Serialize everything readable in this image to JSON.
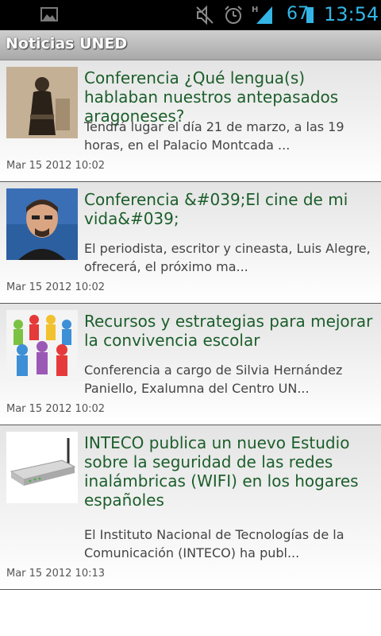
{
  "status_bar": {
    "battery": "67",
    "time": "13:54",
    "network": "H"
  },
  "header": {
    "title": "Noticias UNED"
  },
  "news": [
    {
      "title": "Conferencia ¿Qué lengua(s) hablaban nuestros antepasados aragoneses?",
      "summary": "Tendrá lugar el día 21 de marzo, a las 19 horas, en el Palacio Montcada ...",
      "date": "Mar 15 2012 10:02",
      "thumbnail": "old-photo-woman"
    },
    {
      "title": "Conferencia &#039;El cine de mi vida&#039;",
      "summary": "El periodista, escritor y cineasta, Luis Alegre, ofrecerá, el próximo ma...",
      "date": "Mar 15 2012 10:02",
      "thumbnail": "portrait-man"
    },
    {
      "title": "Recursos y estrategias para mejorar la convivencia escolar",
      "summary": "Conferencia a cargo de Silvia Hernández Paniello, Exalumna del Centro UN...",
      "date": "Mar 15 2012 10:02",
      "thumbnail": "paper-people-circle"
    },
    {
      "title": "INTECO publica un nuevo Estudio sobre la seguridad de las redes inalámbricas (WIFI) en los hogares españoles",
      "summary": "El Instituto Nacional de Tecnologías de la Comunicación (INTECO) ha publ...",
      "date": "Mar 15 2012 10:13",
      "thumbnail": "wifi-router"
    }
  ]
}
